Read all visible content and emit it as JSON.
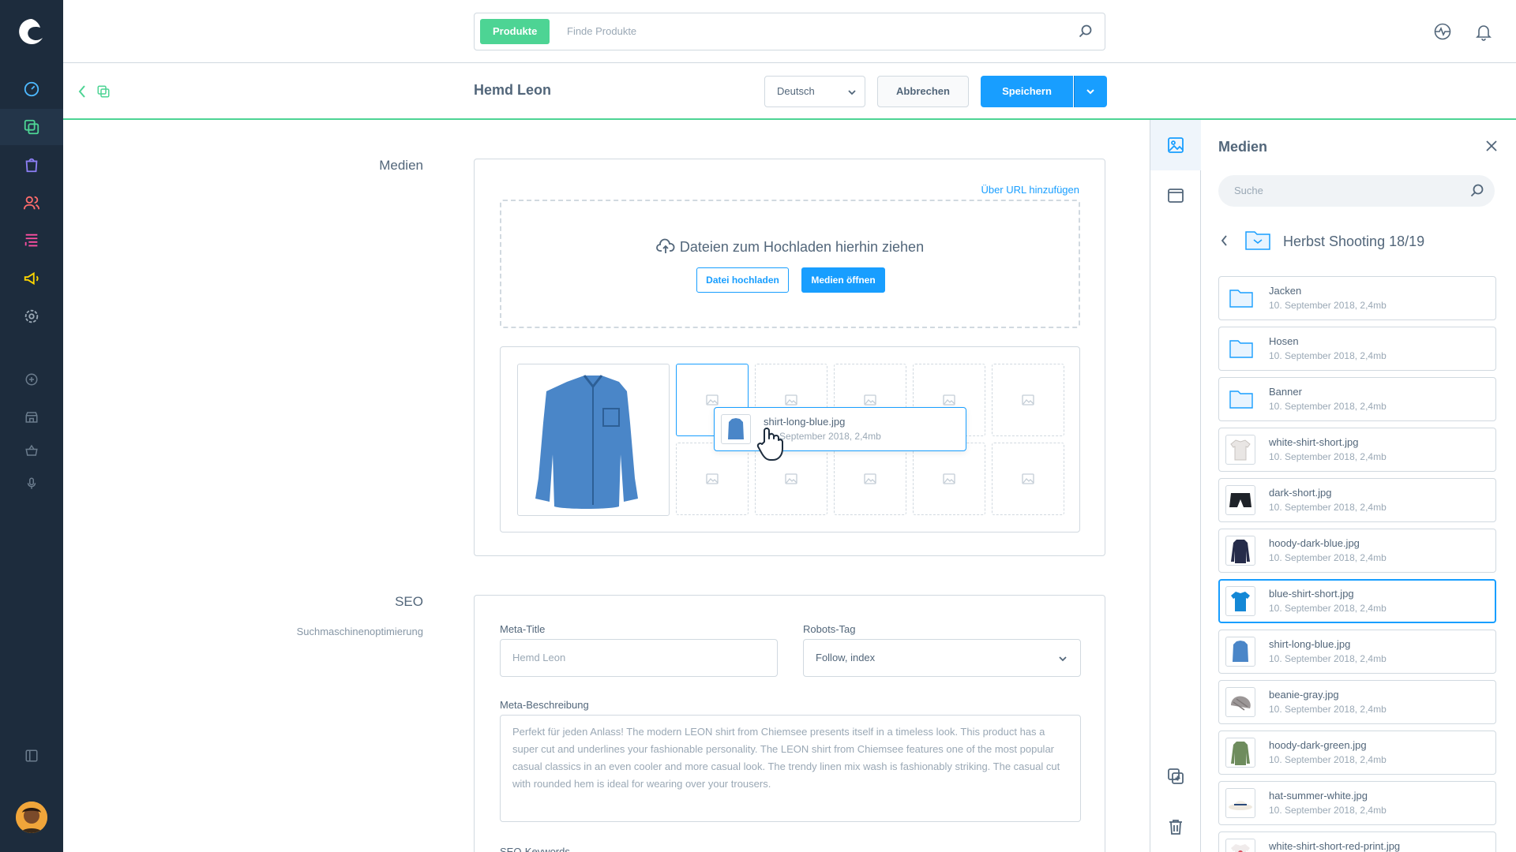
{
  "search": {
    "tag": "Produkte",
    "placeholder": "Finde Produkte"
  },
  "header": {
    "title": "Hemd Leon",
    "language": "Deutsch",
    "cancel_label": "Abbrechen",
    "save_label": "Speichern"
  },
  "media_section": {
    "label": "Medien",
    "add_url_link": "Über URL hinzufügen",
    "dropzone_text": "Dateien zum Hochladen hierhin ziehen",
    "upload_button": "Datei hochladen",
    "open_media_button": "Medien öffnen",
    "drag_item": {
      "name": "shirt-long-blue.jpg",
      "meta": "10. September 2018, 2,4mb"
    }
  },
  "seo_section": {
    "label": "SEO",
    "sublabel": "Suchmaschinenoptimierung",
    "meta_title_label": "Meta-Title",
    "meta_title_placeholder": "Hemd Leon",
    "robots_label": "Robots-Tag",
    "robots_value": "Follow, index",
    "meta_desc_label": "Meta-Beschreibung",
    "meta_desc_placeholder": "Perfekt für jeden Anlass! The modern LEON shirt from Chiemsee presents itself in a timeless look. This product has a super cut and underlines your fashionable personality. The LEON shirt from Chiemsee features one of the most popular casual classics in an even cooler and more casual look. The trendy linen mix wash is fashionably striking. The casual cut with rounded hem is ideal for wearing over your trousers.",
    "keywords_label": "SEO-Keywords"
  },
  "media_panel": {
    "title": "Medien",
    "search_placeholder": "Suche",
    "folder": "Herbst Shooting 18/19",
    "items": [
      {
        "name": "Jacken",
        "meta": "10. September 2018, 2,4mb",
        "kind": "folder"
      },
      {
        "name": "Hosen",
        "meta": "10. September 2018, 2,4mb",
        "kind": "folder"
      },
      {
        "name": "Banner",
        "meta": "10. September 2018, 2,4mb",
        "kind": "folder"
      },
      {
        "name": "white-shirt-short.jpg",
        "meta": "10. September 2018, 2,4mb",
        "kind": "image"
      },
      {
        "name": "dark-short.jpg",
        "meta": "10. September 2018, 2,4mb",
        "kind": "image"
      },
      {
        "name": "hoody-dark-blue.jpg",
        "meta": "10. September 2018, 2,4mb",
        "kind": "image"
      },
      {
        "name": "blue-shirt-short.jpg",
        "meta": "10. September 2018, 2,4mb",
        "kind": "image",
        "selected": true
      },
      {
        "name": "shirt-long-blue.jpg",
        "meta": "10. September 2018, 2,4mb",
        "kind": "image"
      },
      {
        "name": "beanie-gray.jpg",
        "meta": "10. September 2018, 2,4mb",
        "kind": "image"
      },
      {
        "name": "hoody-dark-green.jpg",
        "meta": "10. September 2018, 2,4mb",
        "kind": "image"
      },
      {
        "name": "hat-summer-white.jpg",
        "meta": "10. September 2018, 2,4mb",
        "kind": "image"
      },
      {
        "name": "white-shirt-short-red-print.jpg",
        "meta": "",
        "kind": "image"
      }
    ]
  },
  "colors": {
    "primary": "#189eff",
    "accent_green": "#4dd494",
    "nav_bg": "#1d2c3d"
  }
}
